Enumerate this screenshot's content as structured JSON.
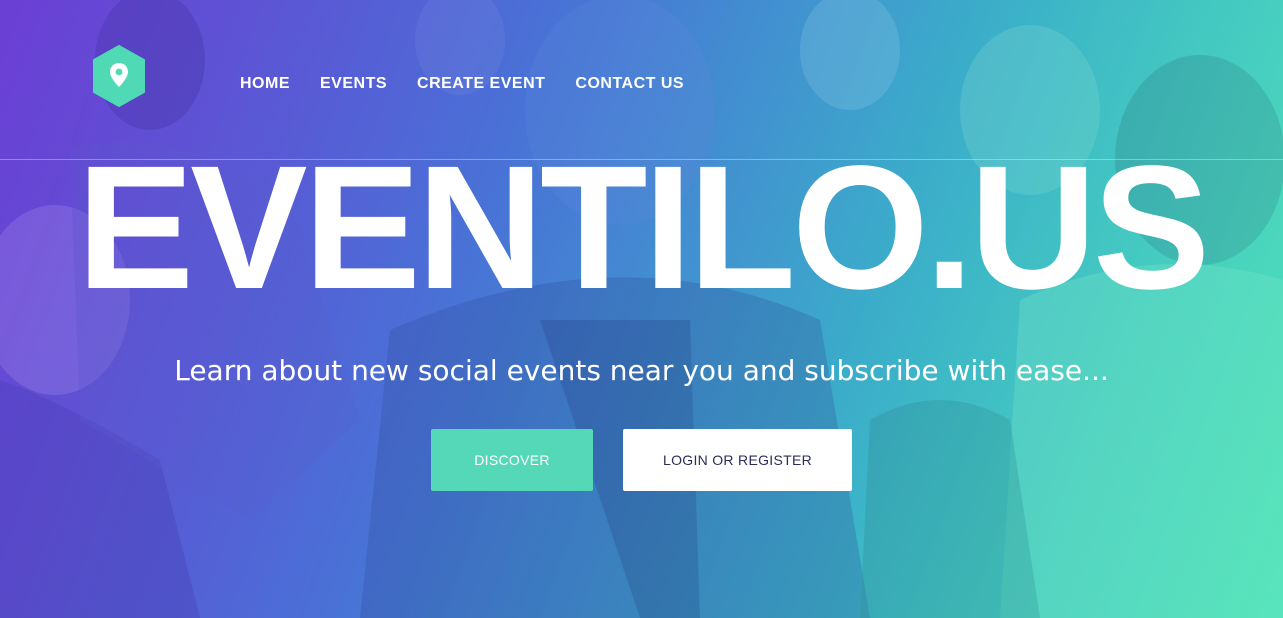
{
  "nav": {
    "items": [
      {
        "label": "HOME"
      },
      {
        "label": "EVENTS"
      },
      {
        "label": "CREATE EVENT"
      },
      {
        "label": "CONTACT US"
      }
    ]
  },
  "hero": {
    "title": "EVENTILO.US",
    "tagline": "Learn about new social events near you and subscribe with ease...",
    "discover_label": "DISCOVER",
    "login_label": "LOGIN OR REGISTER"
  },
  "colors": {
    "gradient_start": "#6a3fd1",
    "gradient_end": "#4ee0b8",
    "accent": "#55d8b7",
    "login_text": "#2b2c5a"
  },
  "icons": {
    "logo": "map-pin-hexagon-icon"
  }
}
